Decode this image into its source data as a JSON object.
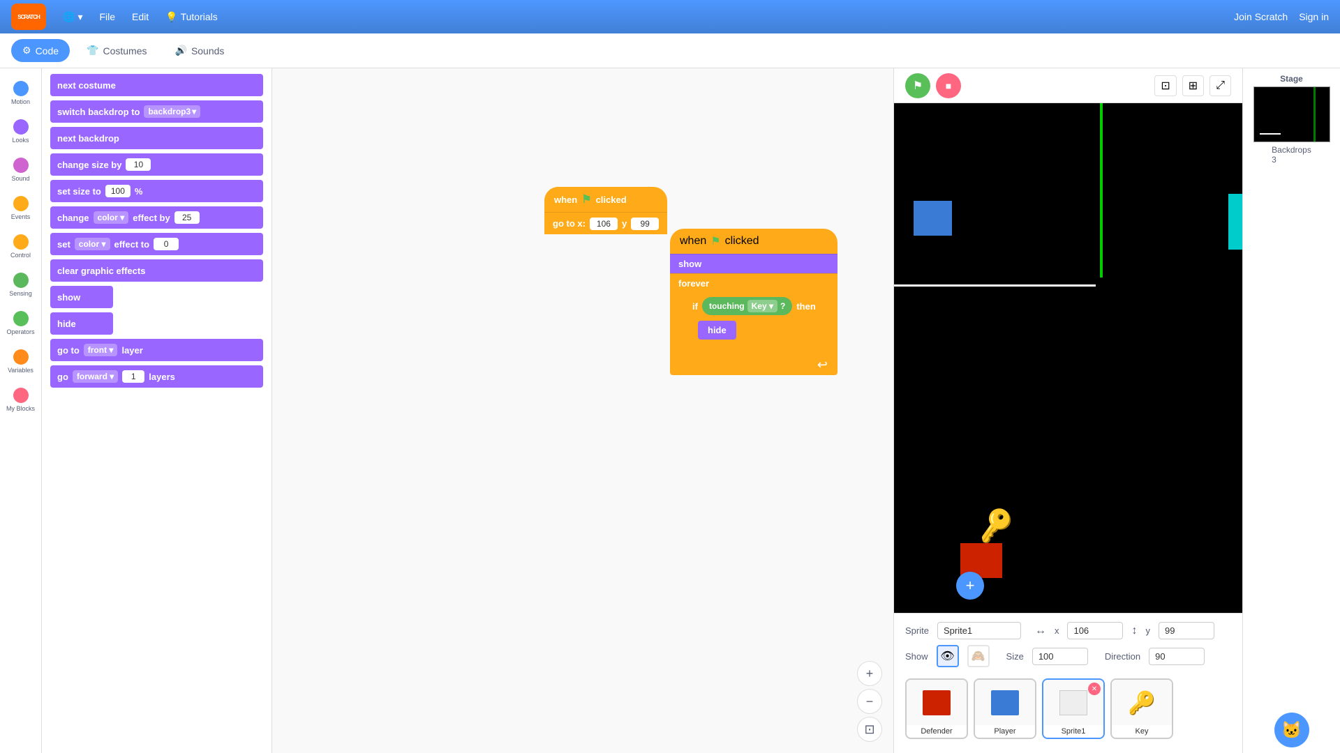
{
  "topbar": {
    "logo": "SCRATCH",
    "globe_label": "🌐",
    "file_label": "File",
    "edit_label": "Edit",
    "tutorials_icon": "💡",
    "tutorials_label": "Tutorials",
    "join_label": "Join Scratch",
    "sign_in_label": "Sign in"
  },
  "tabs": {
    "code_label": "Code",
    "costumes_label": "Costumes",
    "sounds_label": "Sounds"
  },
  "categories": [
    {
      "id": "motion",
      "label": "Motion",
      "color": "#4c97ff"
    },
    {
      "id": "looks",
      "label": "Looks",
      "color": "#9966ff"
    },
    {
      "id": "sound",
      "label": "Sound",
      "color": "#cf63cf"
    },
    {
      "id": "events",
      "label": "Events",
      "color": "#ffab19"
    },
    {
      "id": "control",
      "label": "Control",
      "color": "#ffab19"
    },
    {
      "id": "sensing",
      "label": "Sensing",
      "color": "#5cb85c"
    },
    {
      "id": "operators",
      "label": "Operators",
      "color": "#59c059"
    },
    {
      "id": "variables",
      "label": "Variables",
      "color": "#ff8c1a"
    },
    {
      "id": "myblocks",
      "label": "My Blocks",
      "color": "#ff6680"
    }
  ],
  "blocks": {
    "next_costume": "next costume",
    "switch_backdrop_to": "switch backdrop to",
    "backdrop_value": "backdrop3",
    "next_backdrop": "next backdrop",
    "change_size_by": "change size by",
    "change_size_value": "10",
    "set_size_to": "set size to",
    "set_size_value": "100",
    "set_size_pct": "%",
    "change_color_effect_by": "change",
    "change_color_label": "color",
    "change_color_effect_label": "effect by",
    "change_color_value": "25",
    "set_color_label": "set",
    "set_color_label2": "color",
    "set_effect_label": "effect to",
    "set_effect_value": "0",
    "clear_graphic_effects": "clear graphic effects",
    "show_label": "show",
    "hide_label": "hide",
    "go_to_label": "go to",
    "go_to_front": "front",
    "go_to_layer": "layer",
    "go_forward": "go",
    "go_direction": "forward",
    "go_layers_value": "1",
    "go_layers_label": "layers"
  },
  "script1": {
    "hat": "when 🏁 clicked",
    "goto": "go to x:",
    "x_val": "106",
    "y_label": "y",
    "y_val": "99"
  },
  "script2": {
    "hat": "when 🏁 clicked",
    "show": "show",
    "forever": "forever",
    "if": "if",
    "touching": "touching",
    "key": "Key",
    "arrow": "▾",
    "question": "?",
    "then": "then",
    "hide": "hide"
  },
  "stage_controls": {
    "green_flag": "▶",
    "stop": "■"
  },
  "sprite_info": {
    "sprite_label": "Sprite",
    "sprite_name": "Sprite1",
    "x_label": "x",
    "x_value": "106",
    "y_label": "y",
    "y_value": "99",
    "show_label": "Show",
    "size_label": "Size",
    "size_value": "100",
    "direction_label": "Direction",
    "direction_value": "90"
  },
  "sprites": [
    {
      "name": "Defender",
      "color": "#cc2200",
      "selected": false
    },
    {
      "name": "Player",
      "color": "#3a7bd5",
      "selected": false
    },
    {
      "name": "Sprite1",
      "color": "#ffffff",
      "selected": true,
      "has_delete": true
    },
    {
      "name": "Key",
      "color": "#d4a800",
      "selected": false
    }
  ],
  "stage_panel": {
    "label": "Stage",
    "backdrops_label": "Backdrops",
    "backdrops_count": "3"
  },
  "zoom": {
    "in": "+",
    "out": "−",
    "fit": "⊡"
  }
}
